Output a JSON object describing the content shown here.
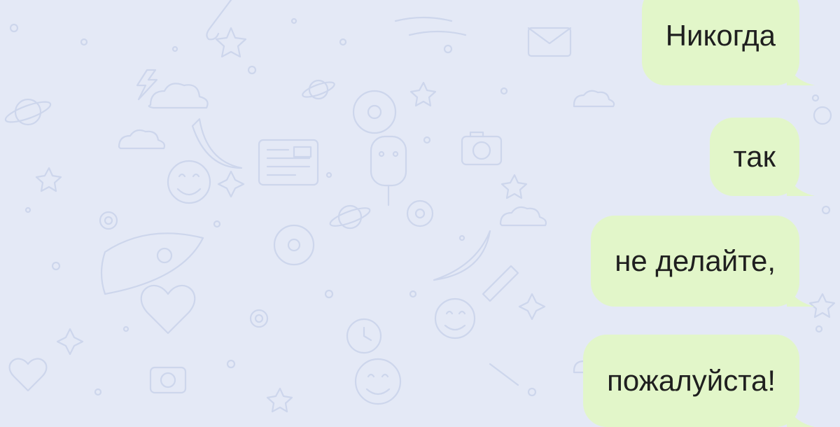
{
  "theme": {
    "background": "#e4e9f6",
    "doodle_color": "#cdd6ec",
    "bubble_color": "#e2f6c9",
    "text_color": "#1f1f1f"
  },
  "messages": [
    {
      "text": "Никогда",
      "direction": "outgoing"
    },
    {
      "text": "так",
      "direction": "outgoing"
    },
    {
      "text": "не делайте,",
      "direction": "outgoing"
    },
    {
      "text": "пожалуйста!",
      "direction": "outgoing"
    }
  ]
}
